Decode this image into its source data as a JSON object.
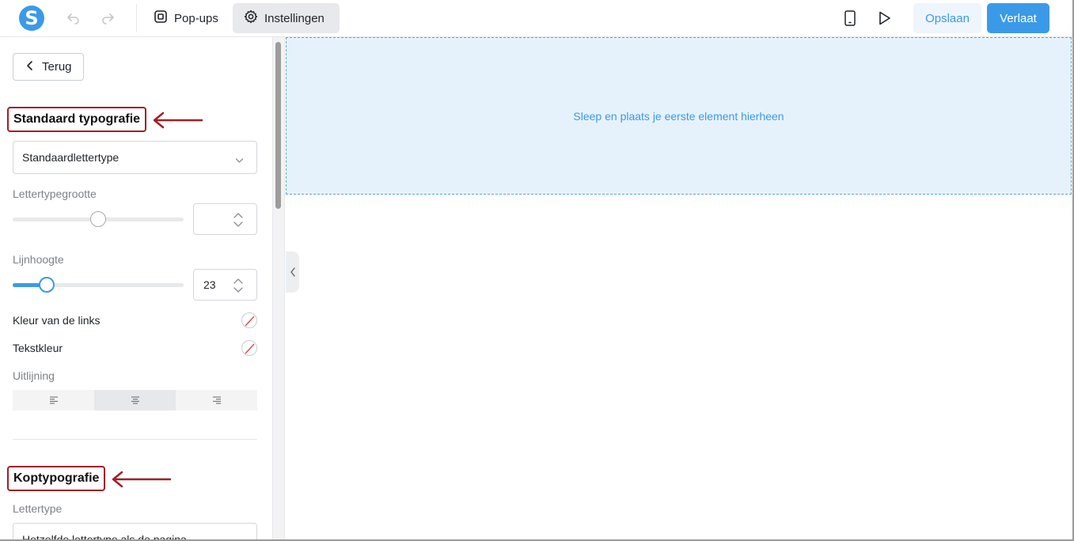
{
  "topbar": {
    "logo_letter": "S",
    "tabs": [
      {
        "label": "Pop-ups",
        "icon": "popup-icon"
      },
      {
        "label": "Instellingen",
        "icon": "gear-icon"
      }
    ],
    "save_label": "Opslaan",
    "leave_label": "Verlaat"
  },
  "sidebar": {
    "back_label": "Terug",
    "standard_typography": {
      "title": "Standaard typografie",
      "font_select_value": "Standaardlettertype",
      "font_size_label": "Lettertypegrootte",
      "font_size_value": "",
      "font_size_level": 0.5,
      "line_height_label": "Lijnhoogte",
      "line_height_value": "23",
      "line_height_level": 0.2,
      "link_color_label": "Kleur van de links",
      "text_color_label": "Tekstkleur",
      "alignment_label": "Uitlijning",
      "alignment_options": [
        "left",
        "center",
        "right"
      ],
      "alignment_selected": "center"
    },
    "heading_typography": {
      "title": "Koptypografie",
      "font_label": "Lettertype",
      "font_select_value": "Hetzelfde lettertype als de pagina"
    }
  },
  "canvas": {
    "dropzone_text": "Sleep en plaats je eerste element hierheen"
  },
  "colors": {
    "accent": "#3b9ae8",
    "annotation": "#a11f24",
    "dropzone_bg": "#e6f2fb"
  }
}
